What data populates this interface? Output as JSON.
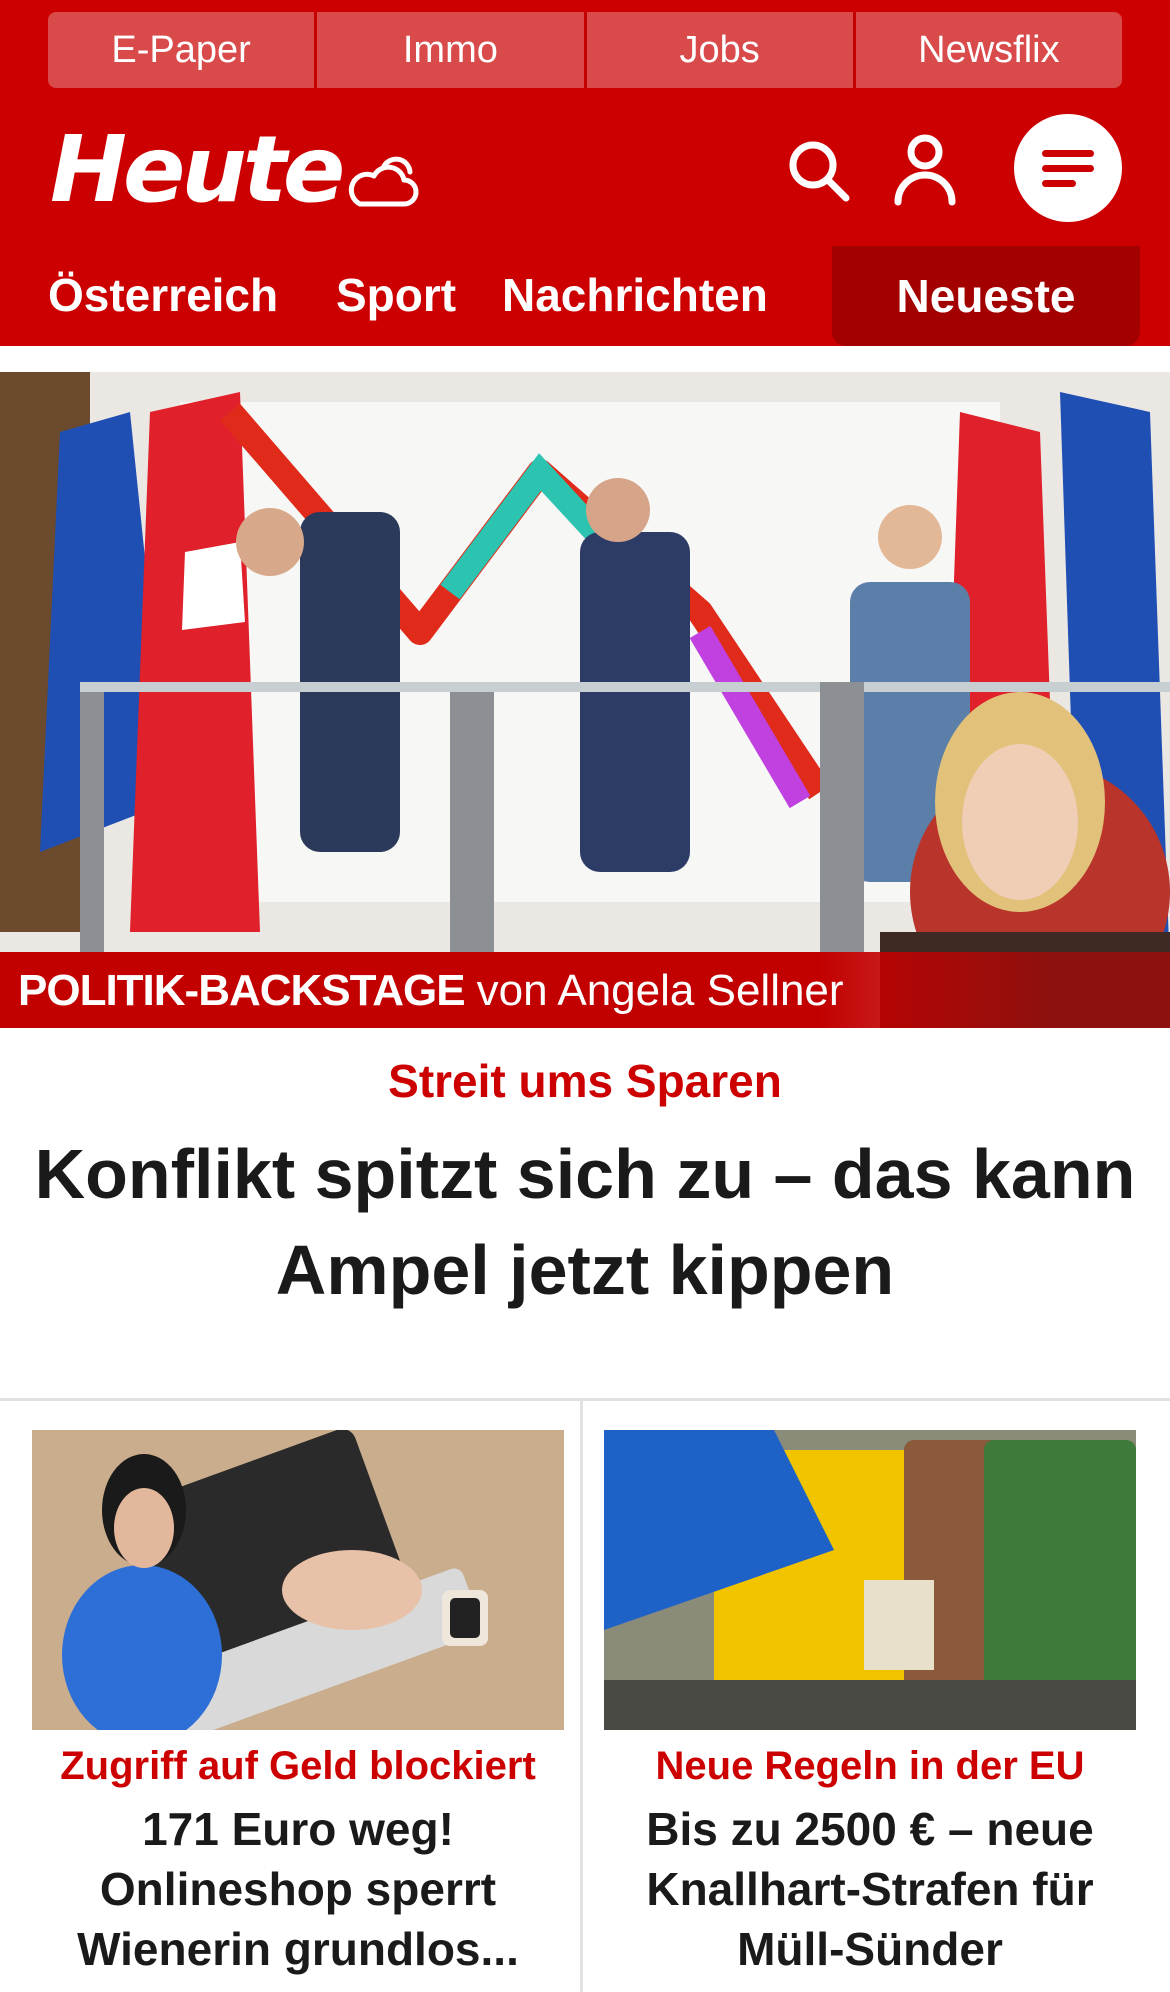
{
  "service_nav": [
    "E-Paper",
    "Immo",
    "Jobs",
    "Newsflix"
  ],
  "brand": {
    "logo_text": "Heute",
    "weather_icon": "cloud-sun-icon",
    "search_icon": "search-icon",
    "user_icon": "user-icon",
    "menu_icon": "menu-icon"
  },
  "main_nav": {
    "items": [
      "Österreich",
      "Sport",
      "Nachrichten"
    ],
    "highlight": "Neueste"
  },
  "hero": {
    "banner_strong": "POLITIK-BACKSTAGE",
    "banner_light": "von Angela Sellner",
    "kicker": "Streit ums Sparen",
    "headline": "Konflikt spitzt sich zu – das kann Ampel jetzt kippen"
  },
  "cards": [
    {
      "kicker": "Zugriff auf Geld blockiert",
      "title": "171 Euro weg! Onlineshop sperrt Wienerin grundlos..."
    },
    {
      "kicker": "Neue Regeln in der EU",
      "title": "Bis zu 2500 € – neue Knallhart-Strafen für Müll-Sünder"
    }
  ],
  "colors": {
    "brand_red": "#cc0000",
    "dark_red": "#a30000",
    "service_bg": "#d94a4a",
    "text": "#1a1a1a"
  }
}
